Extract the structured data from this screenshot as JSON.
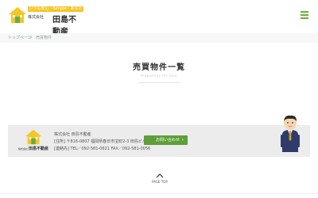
{
  "header": {
    "logo_tagline": "いつも安心・Simple・あなたの",
    "logo_small": "株式会社",
    "logo_name": "田島不動産",
    "menu_icon": "hamburger-menu-icon",
    "brand_color": "#6cac3c",
    "logo_house_color": "#f6c526"
  },
  "breadcrumb": {
    "home": "トップページ",
    "separator": ">",
    "current": "売買物件"
  },
  "main": {
    "title": "売買物件一覧",
    "subtitle": "Properties for sale"
  },
  "footer": {
    "logo_small": "株式会社",
    "logo_name": "田島不動産",
    "company": "株式会社 田島不動産",
    "address": "[住所] 〒816-0807 福岡県春日市宝町2-3 田島ビル1F",
    "phone_fax": "[連絡先] TEL／092-581-0621 FAX／092-581-0056",
    "contact_button": "お問い合わせ",
    "contact_arrow": "›",
    "mascot": "businessman-mascot-illustration"
  },
  "page_top": {
    "label": "PAGE TOP",
    "icon": "chevron-up-icon"
  }
}
